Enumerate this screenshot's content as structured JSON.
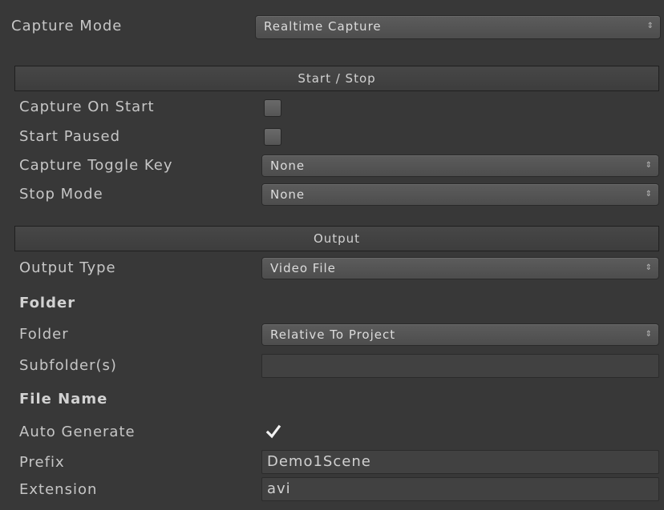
{
  "capture_mode": {
    "label": "Capture Mode",
    "value": "Realtime Capture",
    "arrows": "⇕"
  },
  "start_stop": {
    "header": "Start / Stop",
    "capture_on_start": {
      "label": "Capture On Start",
      "checked": false
    },
    "start_paused": {
      "label": "Start Paused",
      "checked": false
    },
    "capture_toggle_key": {
      "label": "Capture Toggle Key",
      "value": "None"
    },
    "stop_mode": {
      "label": "Stop Mode",
      "value": "None"
    }
  },
  "output": {
    "header": "Output",
    "output_type": {
      "label": "Output Type",
      "value": "Video File"
    },
    "folder_heading": "Folder",
    "folder": {
      "label": "Folder",
      "value": "Relative To Project"
    },
    "subfolders": {
      "label": "Subfolder(s)",
      "value": ""
    },
    "file_name_heading": "File Name",
    "auto_generate": {
      "label": "Auto Generate",
      "checked": true
    },
    "prefix": {
      "label": "Prefix",
      "value": "Demo1Scene"
    },
    "extension": {
      "label": "Extension",
      "value": "avi"
    }
  },
  "icons": {
    "dropdown_arrows": "up-down-arrows-icon",
    "checkmark": "checkmark-icon"
  },
  "colors": {
    "background": "#383838",
    "text": "#c8c8c8",
    "dropdown": "#545454",
    "field": "#414141"
  }
}
